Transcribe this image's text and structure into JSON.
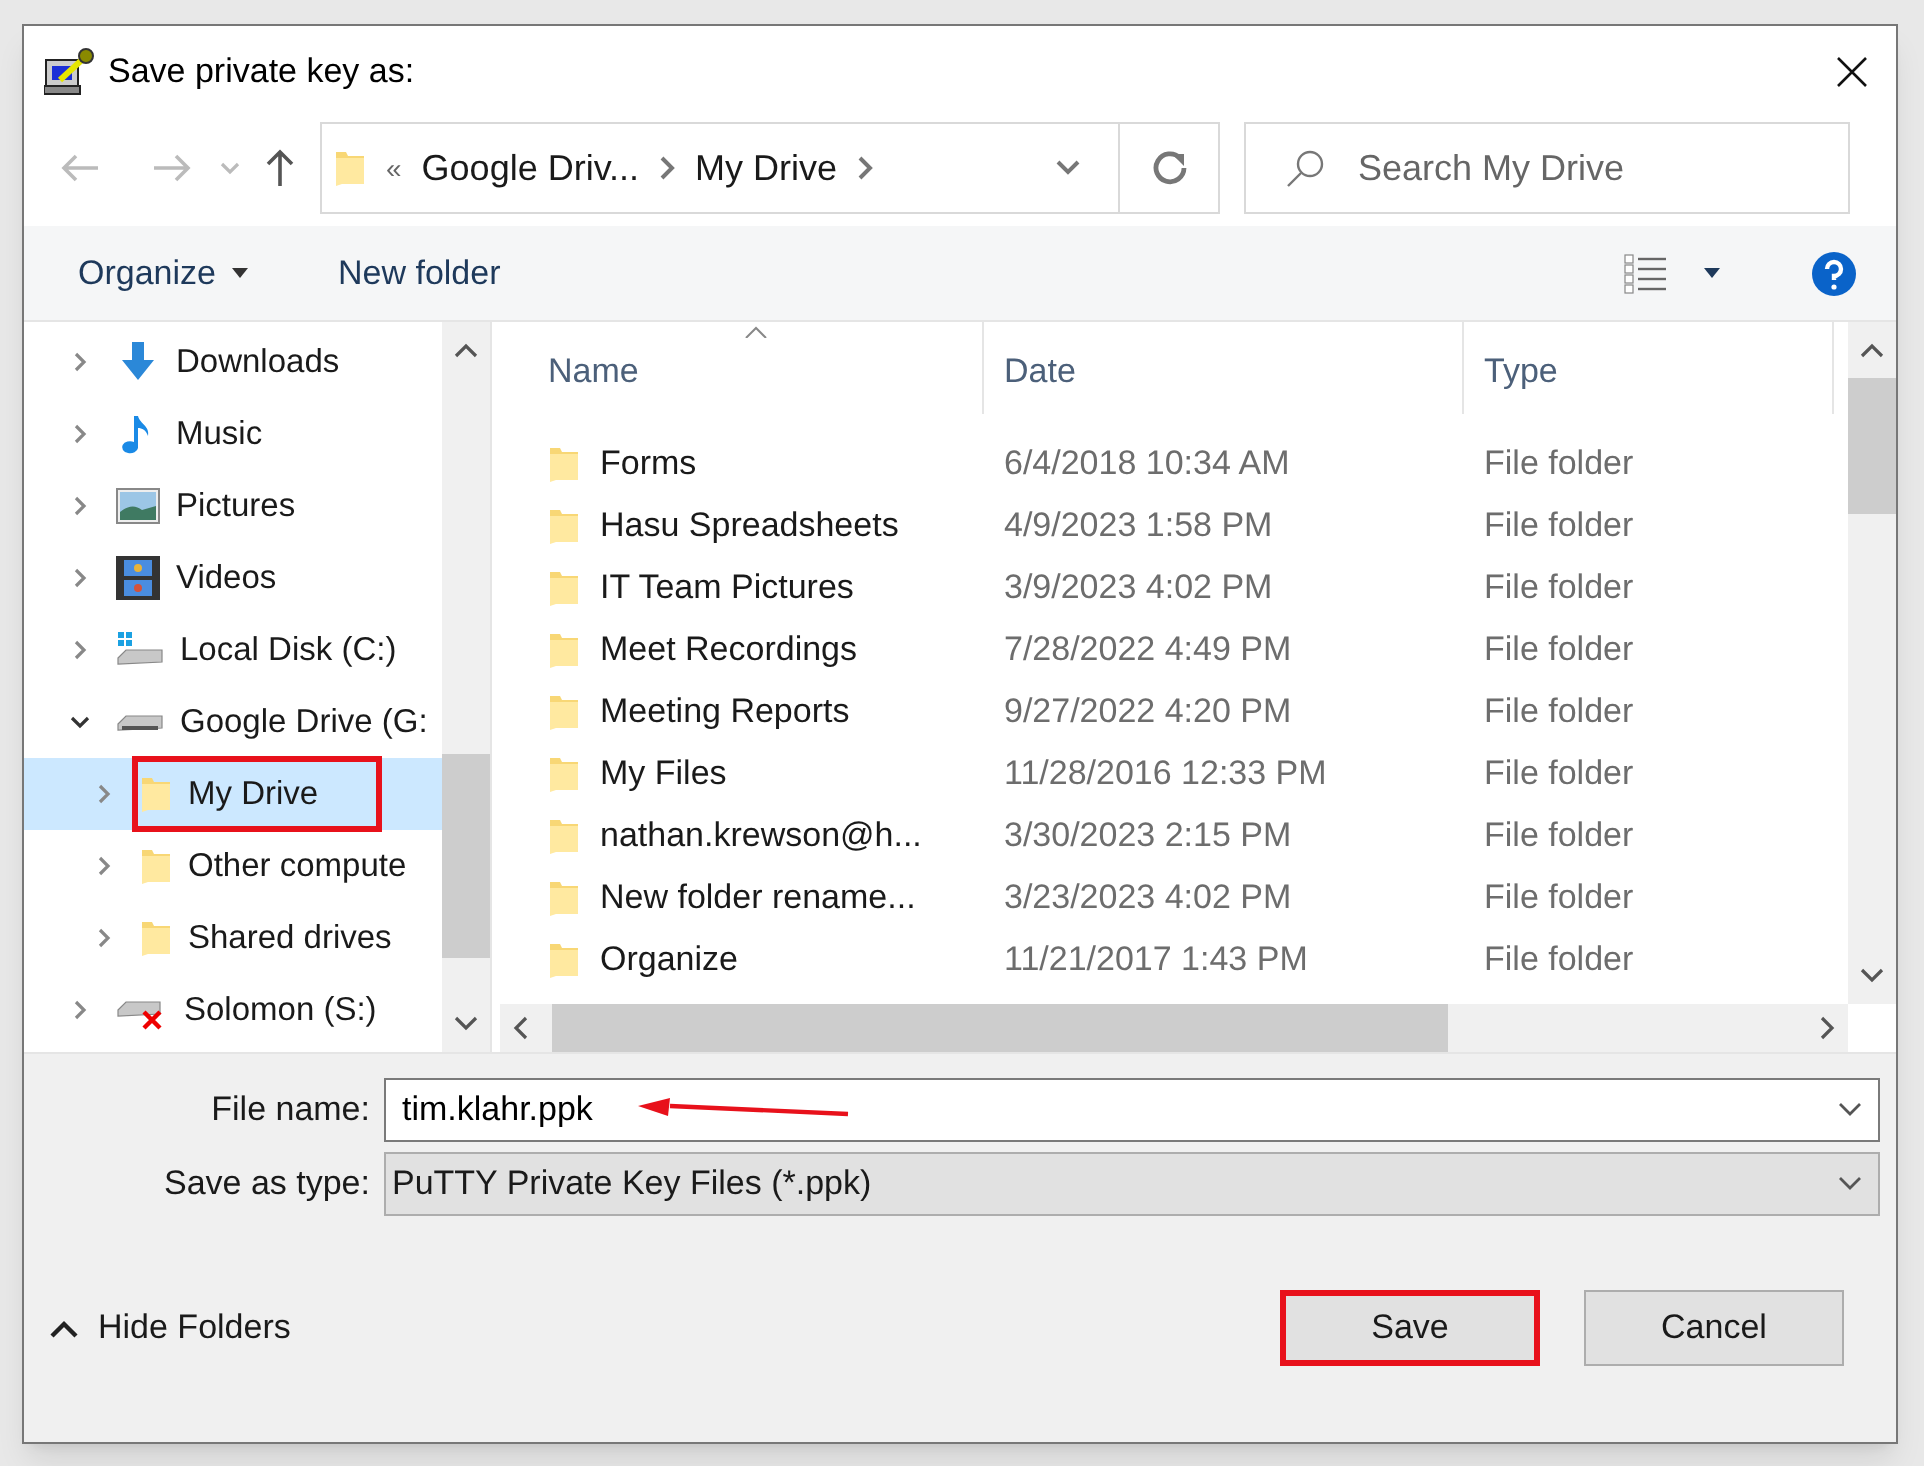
{
  "window": {
    "title": "Save private key as:"
  },
  "address": {
    "overflow": "«",
    "crumbs": [
      "Google Driv...",
      "My Drive"
    ]
  },
  "search": {
    "placeholder": "Search My Drive"
  },
  "toolbar": {
    "organize": "Organize",
    "new_folder": "New folder"
  },
  "nav_tree": [
    {
      "label": "Downloads",
      "kind": "download",
      "expanded": false,
      "selected": false
    },
    {
      "label": "Music",
      "kind": "music",
      "expanded": false,
      "selected": false
    },
    {
      "label": "Pictures",
      "kind": "pictures",
      "expanded": false,
      "selected": false
    },
    {
      "label": "Videos",
      "kind": "videos",
      "expanded": false,
      "selected": false
    },
    {
      "label": "Local Disk (C:)",
      "kind": "disk",
      "expanded": false,
      "selected": false
    },
    {
      "label": "Google Drive (G:",
      "kind": "drive",
      "expanded": true,
      "selected": false,
      "children": [
        {
          "label": "My Drive",
          "kind": "folder",
          "expanded": false,
          "selected": true,
          "annotated": true
        },
        {
          "label": "Other compute",
          "kind": "folder",
          "expanded": false,
          "selected": false
        },
        {
          "label": "Shared drives",
          "kind": "folder",
          "expanded": false,
          "selected": false
        }
      ]
    },
    {
      "label": "Solomon (S:)",
      "kind": "drive_error",
      "expanded": false,
      "selected": false
    }
  ],
  "table": {
    "columns": [
      "Name",
      "Date",
      "Type"
    ],
    "rows": [
      [
        "Forms",
        "6/4/2018 10:34 AM",
        "File folder"
      ],
      [
        "Hasu Spreadsheets",
        "4/9/2023 1:58 PM",
        "File folder"
      ],
      [
        "IT Team Pictures",
        "3/9/2023 4:02 PM",
        "File folder"
      ],
      [
        "Meet Recordings",
        "7/28/2022 4:49 PM",
        "File folder"
      ],
      [
        "Meeting Reports",
        "9/27/2022 4:20 PM",
        "File folder"
      ],
      [
        "My Files",
        "11/28/2016 12:33 PM",
        "File folder"
      ],
      [
        "nathan.krewson@h...",
        "3/30/2023 2:15 PM",
        "File folder"
      ],
      [
        "New folder rename...",
        "3/23/2023 4:02 PM",
        "File folder"
      ],
      [
        "Organize",
        "11/21/2017 1:43 PM",
        "File folder"
      ]
    ]
  },
  "file_name": {
    "label": "File name:",
    "value": "tim.klahr.ppk",
    "annotated": true
  },
  "save_type": {
    "label": "Save as type:",
    "value": "PuTTY Private Key Files (*.ppk)"
  },
  "hide_folders": "Hide Folders",
  "buttons": [
    {
      "label": "Save",
      "annotated": true
    },
    {
      "label": "Cancel",
      "annotated": false
    }
  ]
}
